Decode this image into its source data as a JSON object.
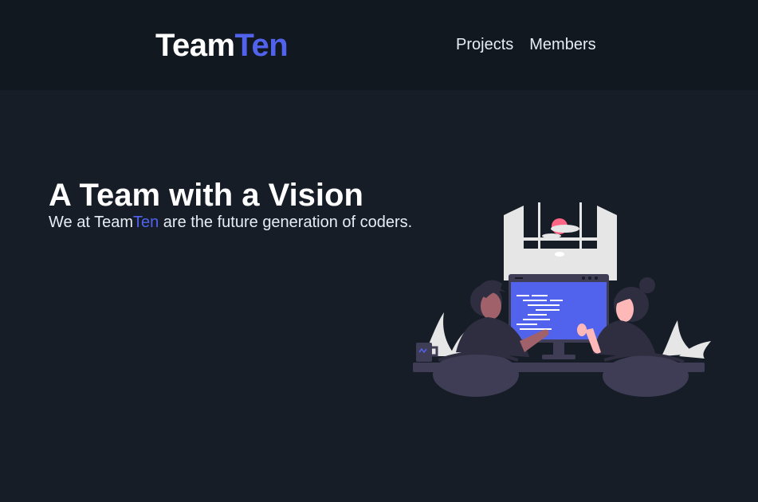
{
  "navbar": {
    "brand_prefix": "Team",
    "brand_accent": "Ten",
    "links": [
      "Projects",
      "Members"
    ]
  },
  "hero": {
    "title": "A Team with a Vision",
    "subtitle_before": "We at Team",
    "subtitle_accent": "Ten",
    "subtitle_after": " are the future generation of coders.",
    "illustration": "team-coding-illustration"
  },
  "colors": {
    "background": "#161d27",
    "navbar": "#111820",
    "accent": "#5163ec",
    "text": "#ffffff"
  }
}
